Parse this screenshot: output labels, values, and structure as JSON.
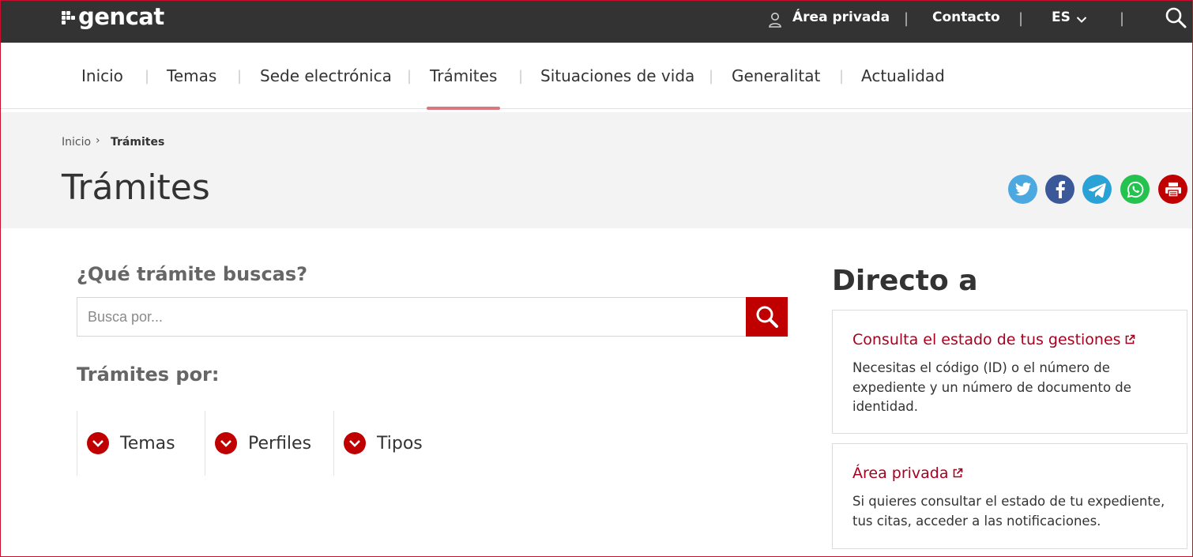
{
  "brand": {
    "name": "gencat"
  },
  "topbar": {
    "private_area": "Área privada",
    "contact": "Contacto",
    "language": "ES"
  },
  "mainnav": {
    "items": [
      "Inicio",
      "Temas",
      "Sede electrónica",
      "Trámites",
      "Situaciones de vida",
      "Generalitat",
      "Actualidad"
    ],
    "active": "Trámites"
  },
  "breadcrumb": {
    "home": "Inicio",
    "current": "Trámites"
  },
  "page": {
    "title": "Trámites"
  },
  "share": {
    "icons": [
      "twitter-icon",
      "facebook-icon",
      "telegram-icon",
      "whatsapp-icon",
      "print-icon"
    ],
    "colors": [
      "#4ba9e0",
      "#3b5998",
      "#2aa2d6",
      "#25c24f",
      "#c00000"
    ]
  },
  "search": {
    "title": "¿Qué trámite buscas?",
    "placeholder": "Busca por..."
  },
  "filters": {
    "title": "Trámites por:",
    "items": [
      "Temas",
      "Perfiles",
      "Tipos"
    ]
  },
  "direct": {
    "title": "Directo a",
    "cards": [
      {
        "link": "Consulta el estado de tus gestiones",
        "text": "Necesitas el código (ID) o el número de expediente y un número de documento de identidad."
      },
      {
        "link": "Área privada",
        "text": "Si quieres consultar el estado de tu expediente, tus citas, acceder a las notificaciones."
      }
    ]
  },
  "colors": {
    "accent": "#c00000",
    "topbar": "#333333",
    "link": "#a8001f",
    "band": "#f3f3f3"
  }
}
